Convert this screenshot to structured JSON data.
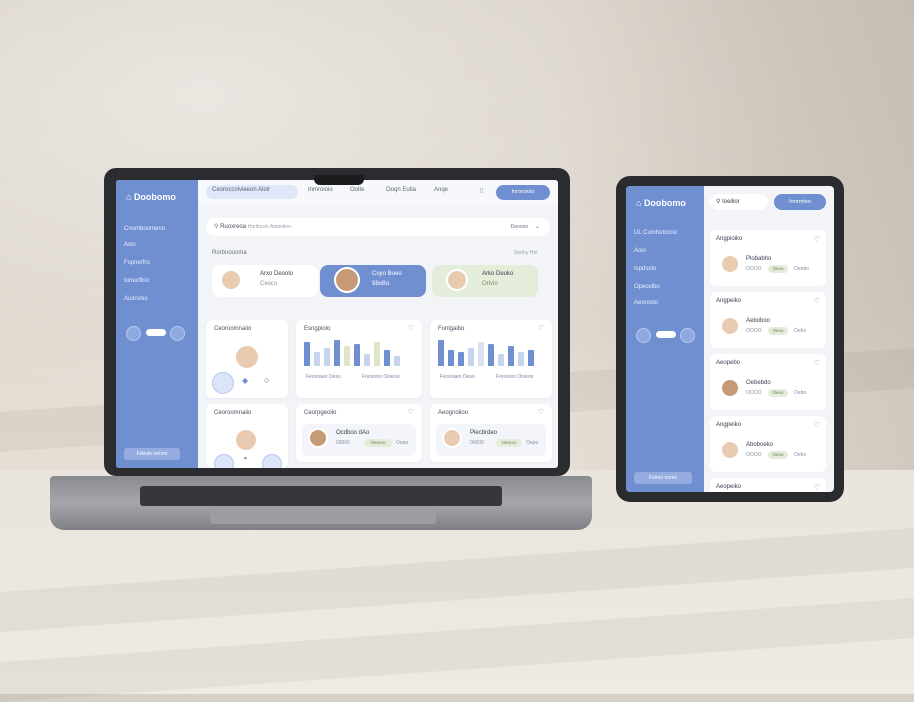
{
  "laptop": {
    "brand": "Doobomo",
    "nav": [
      "Cnomboomeno",
      "Axio",
      "Fspnerfro",
      "Iomorflrio",
      "Auxronio"
    ],
    "side_button": "Fstruio nerom",
    "tabs": {
      "active": "Ceoroccolvieeon Alstr",
      "items": [
        "Inmroioio",
        "Ooite",
        "Ooqn Eutia",
        "Anqe"
      ]
    },
    "cta": "Inroroioio",
    "search": {
      "value": "Ruoxreoa",
      "placeholder": "Horibocio Amoniloo",
      "filter": "Deoseo"
    },
    "profiles_label": "Rorbnoooma",
    "profiles_link": "Sertny Hor",
    "profiles": [
      {
        "name": "Arxo Deoolo",
        "sub": "Ceoco"
      },
      {
        "name": "Cuyo Boeo",
        "sub": "98oBo"
      },
      {
        "name": "Arko Deuko",
        "sub": "Orlvio"
      }
    ],
    "cards": {
      "card1_title": "Ceoroomnaiio",
      "card2_title": "Esngpiolo",
      "card3_title": "Fonlgaibo",
      "card4_title": "Ceoroomnaiio",
      "card5_title": "Ceorpgeoilo",
      "card6_title": "Aeognolioo",
      "legend_a": "Feoroaeo Oeso",
      "legend_b": "Forceoro Oioeoo",
      "person_a": "Ocdboo dAo",
      "person_b": "Plecbrdeo",
      "rating": "00000",
      "tag": "Oeoroo",
      "tag_b": "Oepo"
    }
  },
  "tablet": {
    "brand": "Doobomo",
    "search": "Ioeilior",
    "cta": "Irmrmteo",
    "nav": [
      "UL Comhotorcio",
      "Aoio",
      "Ispdsolo",
      "Opeoslbo",
      "Aeoroolo"
    ],
    "side_button": "Fstroo nome",
    "list": [
      {
        "title": "Angpioiko",
        "name": "Plobabho",
        "rating": "OOOO",
        "tag": "Oeoo",
        "tag_b": "Oeebo"
      },
      {
        "title": "Angpeiko",
        "name": "Aeboboo",
        "rating": "OOOO",
        "tag": "Oeoo",
        "tag_b": "Oebo"
      },
      {
        "title": "Aeopebo",
        "name": "Oebebdo",
        "rating": "OOOO",
        "tag": "Oeoo",
        "tag_b": "Oebo"
      },
      {
        "title": "Angpeiko",
        "name": "Aboboeko",
        "rating": "OOOO",
        "tag": "Oeoo",
        "tag_b": "Oebo"
      }
    ],
    "last_title": "Aeopeiko"
  },
  "colors": {
    "accent": "#6f8fd1",
    "wall": "#d7d0c6",
    "desk": "#ece7df"
  }
}
